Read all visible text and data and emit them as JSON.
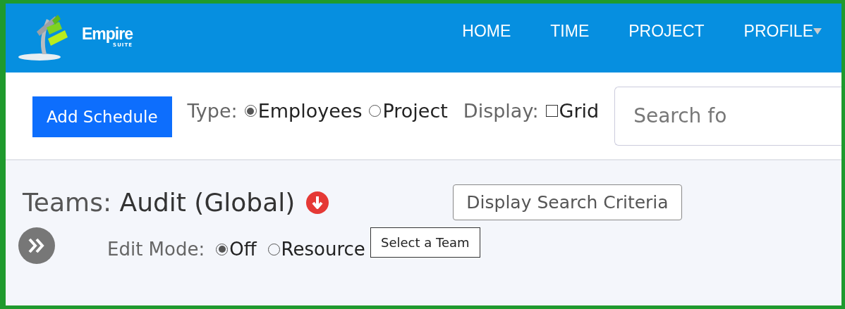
{
  "nav": {
    "logo": {
      "name": "Empire",
      "sub": "SUITE"
    },
    "items": [
      {
        "label": "HOME",
        "caret": false
      },
      {
        "label": "TIME",
        "caret": false
      },
      {
        "label": "PROJECT",
        "caret": false
      },
      {
        "label": "PROFILE",
        "caret": true
      }
    ]
  },
  "toolbar": {
    "add_button": "Add Schedule",
    "type": {
      "label": "Type:",
      "options": [
        {
          "label": "Employees",
          "selected": true
        },
        {
          "label": "Project",
          "selected": false
        }
      ]
    },
    "display": {
      "label": "Display:",
      "options": [
        {
          "label": "Grid",
          "checked": false
        }
      ]
    },
    "search": {
      "placeholder": "Search fo"
    }
  },
  "teams": {
    "label": "Teams:",
    "value": "Audit (Global)",
    "tooltip": "Select a Team",
    "criteria_button": "Display Search Criteria",
    "edit_mode": {
      "label": "Edit Mode:",
      "options": [
        {
          "label": "Off",
          "selected": true
        },
        {
          "label": "Resource",
          "selected": false
        }
      ]
    }
  }
}
